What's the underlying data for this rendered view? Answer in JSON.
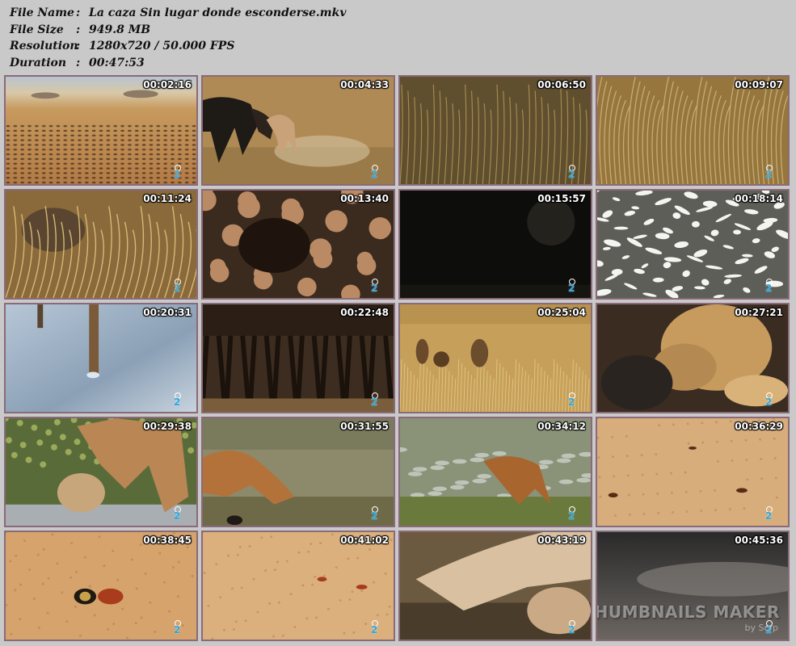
{
  "info": [
    {
      "label": "File Name",
      "value": "La caza Sin lugar donde esconderse.mkv"
    },
    {
      "label": "File Size",
      "value": "949.8 MB"
    },
    {
      "label": "Resolution",
      "value": "1280x720 / 50.000 FPS"
    },
    {
      "label": "Duration",
      "value": "00:47:53"
    }
  ],
  "separator": ":",
  "channel_logo_text": "2",
  "thumbnails": [
    {
      "time": "00:02:16",
      "scene": "savanna-herd"
    },
    {
      "time": "00:04:33",
      "scene": "wildebeest-chase"
    },
    {
      "time": "00:06:50",
      "scene": "tall-grass"
    },
    {
      "time": "00:09:07",
      "scene": "dry-grass"
    },
    {
      "time": "00:11:24",
      "scene": "grass-closeup"
    },
    {
      "time": "00:13:40",
      "scene": "rock-cave"
    },
    {
      "time": "00:15:57",
      "scene": "dark"
    },
    {
      "time": "00:18:14",
      "scene": "birds-flock"
    },
    {
      "time": "00:20:31",
      "scene": "frozen-water"
    },
    {
      "time": "00:22:48",
      "scene": "herd-legs"
    },
    {
      "time": "00:25:04",
      "scene": "lion-cubs"
    },
    {
      "time": "00:27:21",
      "scene": "lion-eating"
    },
    {
      "time": "00:29:38",
      "scene": "jackal-pup"
    },
    {
      "time": "00:31:55",
      "scene": "jackal-hunting"
    },
    {
      "time": "00:34:12",
      "scene": "jackal-walking"
    },
    {
      "time": "00:36:29",
      "scene": "sand-ants"
    },
    {
      "time": "00:38:45",
      "scene": "sand-insect"
    },
    {
      "time": "00:41:02",
      "scene": "sand-ants-2"
    },
    {
      "time": "00:43:19",
      "scene": "lion-paw"
    },
    {
      "time": "00:45:36",
      "scene": "dust-storm"
    }
  ],
  "watermark": {
    "title": "VIDEO THUMBNAILS MAKER",
    "sub": "by Scrp"
  }
}
